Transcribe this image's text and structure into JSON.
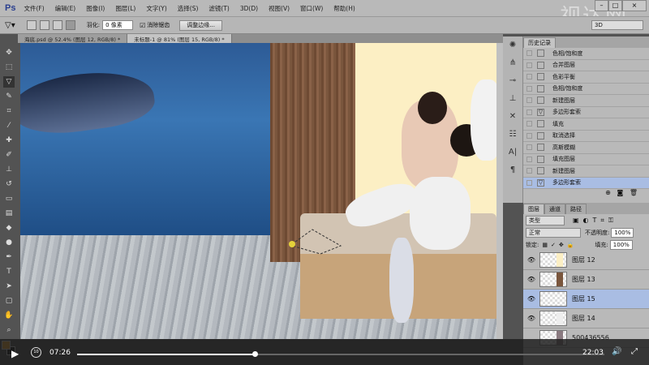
{
  "app": {
    "logo": "Ps",
    "watermark": "视达网"
  },
  "menu": [
    "文件(F)",
    "编辑(E)",
    "图像(I)",
    "图层(L)",
    "文字(Y)",
    "选择(S)",
    "滤镜(T)",
    "3D(D)",
    "视图(V)",
    "窗口(W)",
    "帮助(H)"
  ],
  "window_controls": {
    "minimize": "–",
    "maximize": "□",
    "close": "×"
  },
  "options": {
    "feather_label": "羽化:",
    "feather_value": "0 像素",
    "antialias_label": "消除锯齿",
    "antialias_checked": true,
    "refine_edge": "调整边缘...",
    "workspace": "3D"
  },
  "tabs": [
    {
      "label": "海底.psd @ 52.4% (图层 12, RGB/8) *",
      "active": false
    },
    {
      "label": "未标题-1 @ 81% (图层 15, RGB/8) *",
      "active": true
    }
  ],
  "history": {
    "title": "历史记录",
    "items": [
      "色相/饱和度",
      "合并图层",
      "色彩平衡",
      "色相/饱和度",
      "新建图层",
      "多边形套索",
      "填充",
      "取消选择",
      "高斯模糊",
      "填充图层",
      "新建图层",
      "多边形套索"
    ],
    "selected_index": 11
  },
  "layers": {
    "tabs": [
      "图层",
      "通道",
      "路径"
    ],
    "filter": "类型",
    "blend_mode": "正常",
    "opacity_label": "不透明度:",
    "opacity": "100%",
    "lock_label": "锁定:",
    "fill_label": "填充:",
    "fill": "100%",
    "items": [
      {
        "name": "图层 12",
        "selected": false
      },
      {
        "name": "图层 13",
        "selected": false
      },
      {
        "name": "图层 15",
        "selected": true
      },
      {
        "name": "图层 14",
        "selected": false
      },
      {
        "name": "500436556",
        "selected": false
      }
    ]
  },
  "video": {
    "current_time": "07:26",
    "duration": "22:03",
    "progress": 0.337,
    "rewind_label": "10"
  },
  "colors": {
    "accent_selected": "#a9bde3",
    "foreground": "#f5a623"
  }
}
